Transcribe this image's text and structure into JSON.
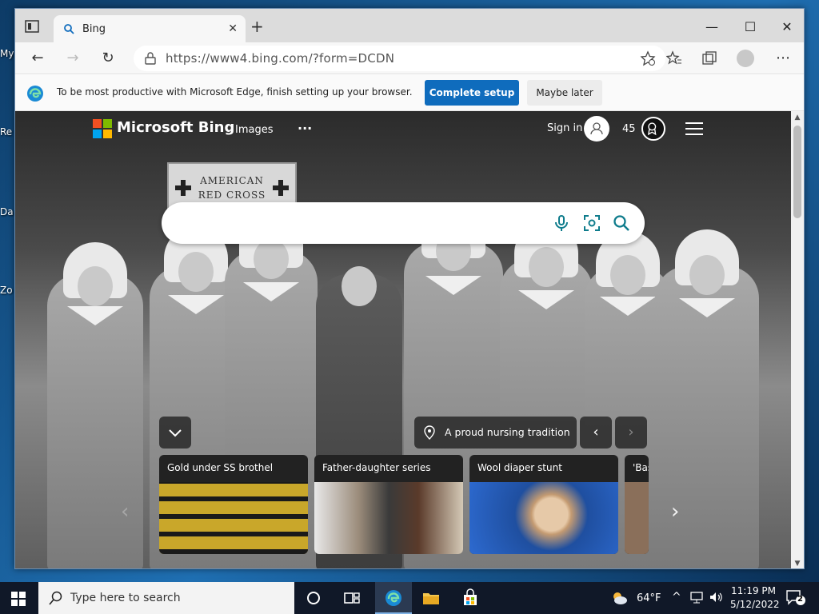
{
  "desktop": {
    "icon_labels": [
      "My",
      "Re",
      "Da",
      "Zo"
    ]
  },
  "browser": {
    "tab_title": "Bing",
    "url": "https://www4.bing.com/?form=DCDN",
    "infobar": {
      "message": "To be most productive with Microsoft Edge, finish setting up your browser.",
      "primary_label": "Complete setup",
      "secondary_label": "Maybe later"
    }
  },
  "bing": {
    "brand": "Microsoft Bing",
    "nav_images": "Images",
    "nav_more": "···",
    "signin_label": "Sign in",
    "points": "45",
    "search_value": "",
    "sign_line1": "AMERICAN",
    "sign_line2": "RED CROSS",
    "caption": "A proud nursing tradition",
    "cards": [
      {
        "title": "Gold under SS brothel"
      },
      {
        "title": "Father-daughter series"
      },
      {
        "title": "Wool diaper stunt"
      },
      {
        "title": "'Bas"
      }
    ]
  },
  "taskbar": {
    "search_placeholder": "Type here to search",
    "weather": "64°F",
    "time": "11:19 PM",
    "date": "5/12/2022",
    "notification_count": "2"
  },
  "colors": {
    "accent": "#0f6cbd",
    "taskbar": "#101828"
  }
}
